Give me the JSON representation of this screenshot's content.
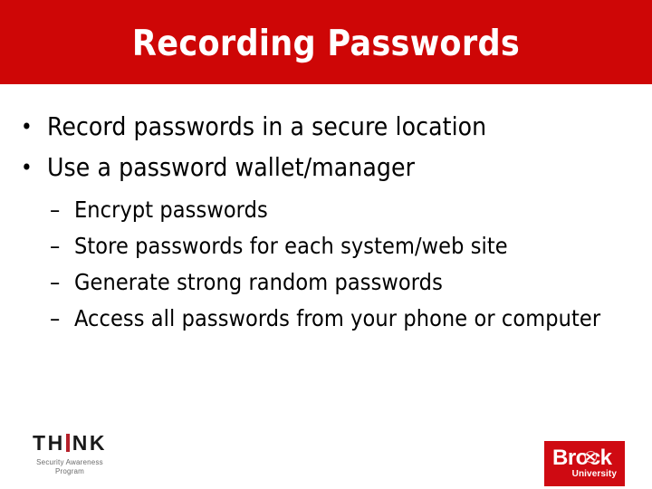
{
  "slide": {
    "title": "Recording Passwords",
    "title_band_color": "#ce0606",
    "background_color": "#ffffff",
    "text_color": "#000000"
  },
  "content": {
    "level1_marker": "•",
    "level2_marker": "–",
    "bullets": [
      {
        "text": "Record passwords in a secure location"
      },
      {
        "text": "Use a password wallet/manager"
      }
    ],
    "sub_bullets": [
      {
        "text": "Encrypt passwords"
      },
      {
        "text": "Store passwords for each system/web site"
      },
      {
        "text": "Generate strong random passwords"
      },
      {
        "text": "Access all passwords from your phone or computer"
      }
    ]
  },
  "think_logo": {
    "part1": "TH",
    "part2": "NK",
    "subtitle_line1": "Security Awareness",
    "subtitle_line2": "Program",
    "accent_color": "#b5202a",
    "text_color": "#1a1a1a",
    "subtitle_color": "#6b6b6b"
  },
  "brock_logo": {
    "name": "Brock",
    "subtitle": "University",
    "background_color": "#cf0a12",
    "text_color": "#ffffff"
  }
}
